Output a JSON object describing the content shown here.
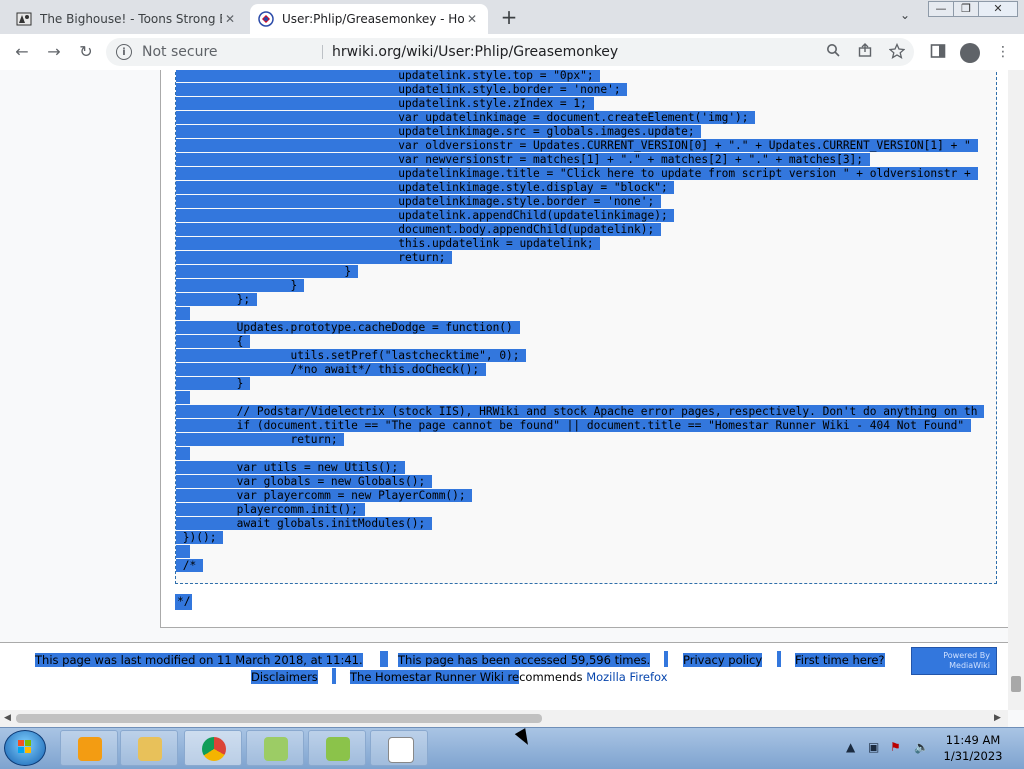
{
  "window": {
    "controls": {
      "minimize": "—",
      "maximize": "❐",
      "close": "✕"
    }
  },
  "tabs": [
    {
      "title": "The Bighouse! - Toons Strong Ba",
      "close": "✕",
      "active": false
    },
    {
      "title": "User:Phlip/Greasemonkey - Hom",
      "close": "✕",
      "active": true
    }
  ],
  "toolbar": {
    "new_tab": "+",
    "tab_search": "⌄",
    "back": "←",
    "forward": "→",
    "reload": "↻",
    "security_label": "Not secure",
    "url": "hrwiki.org/wiki/User:Phlip/Greasemonkey"
  },
  "code": {
    "lines": [
      {
        "indent": 32,
        "text": "updatelink.style.top = \"0px\";",
        "fill": 0
      },
      {
        "indent": 32,
        "text": "updatelink.style.border = 'none';",
        "fill": 0
      },
      {
        "indent": 32,
        "text": "updatelink.style.zIndex = 1;",
        "fill": 0
      },
      {
        "indent": 32,
        "text": "var updatelinkimage = document.createElement('img');",
        "fill": 0
      },
      {
        "indent": 32,
        "text": "updatelinkimage.src = globals.images.update;",
        "fill": 0
      },
      {
        "indent": 32,
        "text": "var oldversionstr = Updates.CURRENT_VERSION[0] + \".\" + Updates.CURRENT_VERSION[1] + \"",
        "fill": 1
      },
      {
        "indent": 32,
        "text": "var newversionstr = matches[1] + \".\" + matches[2] + \".\" + matches[3];",
        "fill": 0
      },
      {
        "indent": 32,
        "text": "updatelinkimage.title = \"Click here to update from script version \" + oldversionstr +",
        "fill": 1
      },
      {
        "indent": 32,
        "text": "updatelinkimage.style.display = \"block\";",
        "fill": 0
      },
      {
        "indent": 32,
        "text": "updatelinkimage.style.border = 'none';",
        "fill": 0
      },
      {
        "indent": 32,
        "text": "updatelink.appendChild(updatelinkimage);",
        "fill": 0
      },
      {
        "indent": 32,
        "text": "document.body.appendChild(updatelink);",
        "fill": 0
      },
      {
        "indent": 32,
        "text": "this.updatelink = updatelink;",
        "fill": 0
      },
      {
        "indent": 32,
        "text": "return;",
        "fill": 0
      },
      {
        "indent": 24,
        "text": "}",
        "fill": 0
      },
      {
        "indent": 16,
        "text": "}",
        "fill": 0
      },
      {
        "indent": 8,
        "text": "};",
        "fill": 0
      },
      {
        "indent": 0,
        "text": "",
        "fill": 0
      },
      {
        "indent": 8,
        "text": "Updates.prototype.cacheDodge = function()",
        "fill": 0
      },
      {
        "indent": 8,
        "text": "{",
        "fill": 0
      },
      {
        "indent": 16,
        "text": "utils.setPref(\"lastchecktime\", 0);",
        "fill": 0
      },
      {
        "indent": 16,
        "text": "/*no await*/ this.doCheck();",
        "fill": 0
      },
      {
        "indent": 8,
        "text": "}",
        "fill": 0
      },
      {
        "indent": 0,
        "text": "",
        "fill": 0
      },
      {
        "indent": 8,
        "text": "// Podstar/Videlectrix (stock IIS), HRWiki and stock Apache error pages, respectively. Don't do anything on th",
        "fill": 1
      },
      {
        "indent": 8,
        "text": "if (document.title == \"The page cannot be found\" || document.title == \"Homestar Runner Wiki - 404 Not Found\"",
        "fill": 1
      },
      {
        "indent": 16,
        "text": "return;",
        "fill": 0
      },
      {
        "indent": 0,
        "text": "",
        "fill": 0
      },
      {
        "indent": 8,
        "text": "var utils = new Utils();",
        "fill": 0
      },
      {
        "indent": 8,
        "text": "var globals = new Globals();",
        "fill": 0
      },
      {
        "indent": 8,
        "text": "var playercomm = new PlayerComm();",
        "fill": 0
      },
      {
        "indent": 8,
        "text": "playercomm.init();",
        "fill": 0
      },
      {
        "indent": 8,
        "text": "await globals.initModules();",
        "fill": 0
      },
      {
        "indent": 0,
        "text": "})();",
        "fill": 0
      },
      {
        "indent": 0,
        "text": "",
        "fill": 0
      },
      {
        "indent": 0,
        "text": "/*",
        "fill": 0
      }
    ],
    "trailing": "*/"
  },
  "footer": {
    "last_modified": "This page was last modified on 11 March 2018, at 11:41.",
    "accessed": "This page has been accessed 59,596 times.",
    "privacy": "Privacy policy",
    "first_time": "First time here?",
    "disclaimers": "Disclaimers",
    "recommends_selected": "The Homestar Runner Wiki re",
    "recommends_rest": "commends ",
    "firefox": "Mozilla Firefox",
    "powered_by": "Powered By MediaWiki"
  },
  "taskbar": {
    "time": "11:49 AM",
    "date": "1/31/2023"
  }
}
